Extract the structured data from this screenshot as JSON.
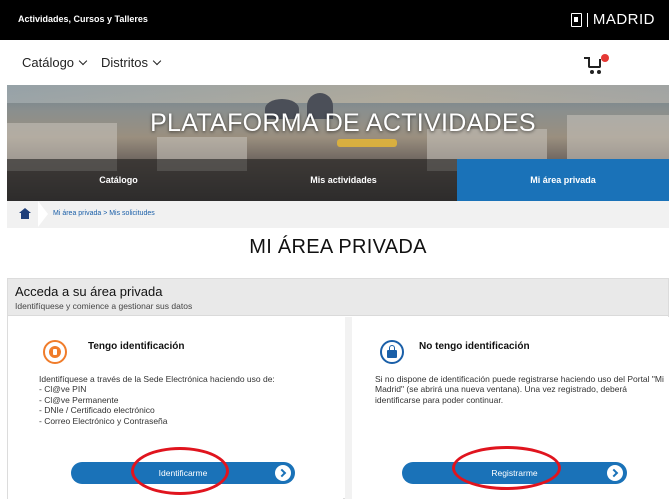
{
  "topbar": {
    "site_title": "Actividades, Cursos y Talleres",
    "brand": "MADRID"
  },
  "nav": {
    "items": [
      "Catálogo",
      "Distritos"
    ]
  },
  "hero": {
    "title": "PLATAFORMA DE ACTIVIDADES",
    "tabs": [
      "Catálogo",
      "Mis actividades",
      "Mi área privada"
    ]
  },
  "breadcrumb": {
    "path": "Mi área privada > Mis solicitudes"
  },
  "page_title": "MI ÁREA PRIVADA",
  "panel": {
    "heading": "Acceda a su área privada",
    "subheading": "Identifíquese y comience a gestionar sus datos"
  },
  "left": {
    "title": "Tengo identificación",
    "intro": "Identifíquese a través de la Sede Electrónica haciendo uso de:",
    "options": [
      "- Cl@ve PIN",
      "- Cl@ve Permanente",
      "- DNIe / Certificado electrónico",
      "- Correo Electrónico y Contraseña"
    ],
    "button": "Identificarme"
  },
  "right": {
    "title": "No tengo identificación",
    "desc": "Si no dispone de identificación puede registrarse haciendo uso del Portal \"Mi Madrid\" (se abrirá una nueva ventana). Una vez registrado, deberá identificarse para poder continuar.",
    "button": "Registrarme"
  },
  "colors": {
    "accent": "#1a72b8",
    "orange": "#f07c2a",
    "highlight": "#e0141e"
  },
  "icons": {
    "brand": "madrid-crest-icon",
    "cart": "shopping-cart-icon",
    "home": "home-icon",
    "left": "id-card-icon",
    "right": "lock-icon",
    "arrow": "arrow-right-circle-icon"
  }
}
